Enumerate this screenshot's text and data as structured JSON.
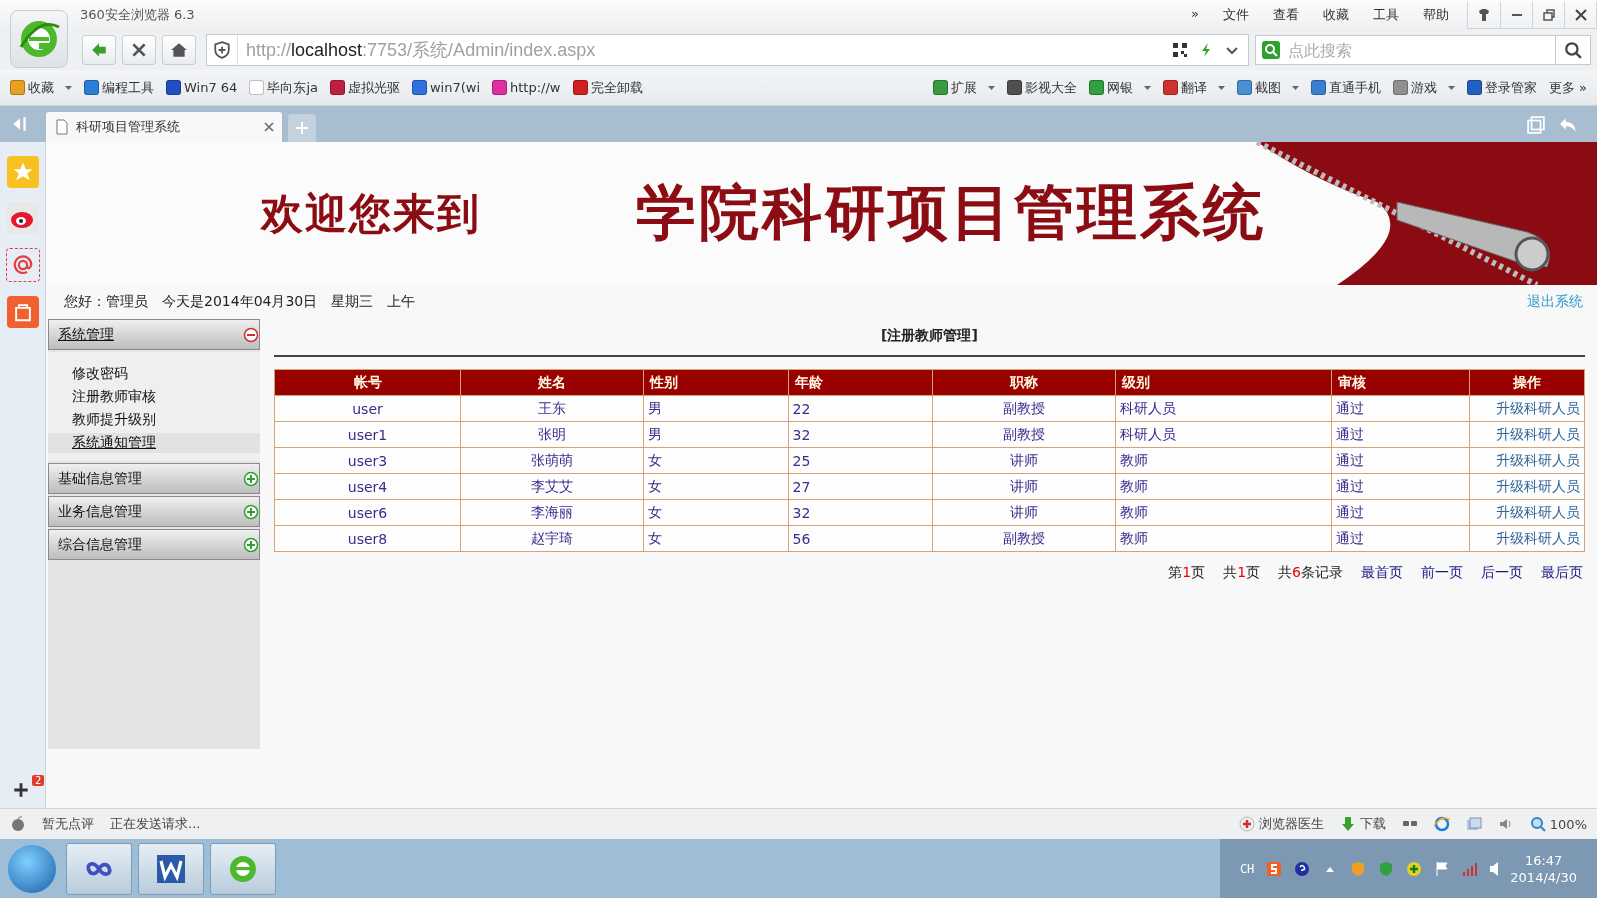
{
  "browser": {
    "title": "360安全浏览器 6.3",
    "menu": [
      "»",
      "文件",
      "查看",
      "收藏",
      "工具",
      "帮助"
    ],
    "url": "http://**localhost**:7753/系统/Admin/index.aspx",
    "search_placeholder": "点此搜索"
  },
  "bookmarks": [
    {
      "label": "收藏",
      "dropdown": true,
      "color": "#e8a020"
    },
    {
      "label": "编程工具",
      "dropdown": false,
      "color": "#2a7fd4"
    },
    {
      "label": "Win7 64",
      "dropdown": false,
      "color": "#2050c0"
    },
    {
      "label": "毕向东ja",
      "dropdown": false,
      "color": "#ffffff"
    },
    {
      "label": "虚拟光驱",
      "dropdown": false,
      "color": "#c02040"
    },
    {
      "label": "win7(wi",
      "dropdown": false,
      "color": "#3070e0"
    },
    {
      "label": "http://w",
      "dropdown": false,
      "color": "#e030a0"
    },
    {
      "label": "完全卸载",
      "dropdown": false,
      "color": "#d02020"
    }
  ],
  "toolbar_right": [
    {
      "label": "扩展",
      "dropdown": true,
      "color": "#3a9a40"
    },
    {
      "label": "影视大全",
      "dropdown": false,
      "color": "#505050"
    },
    {
      "label": "网银",
      "dropdown": true,
      "color": "#30a040"
    },
    {
      "label": "翻译",
      "dropdown": true,
      "color": "#d03030"
    },
    {
      "label": "截图",
      "dropdown": true,
      "color": "#4a90d0"
    },
    {
      "label": "直通手机",
      "dropdown": false,
      "color": "#3a80d0"
    },
    {
      "label": "游戏",
      "dropdown": true,
      "color": "#909090"
    },
    {
      "label": "登录管家",
      "dropdown": false,
      "color": "#2060c0"
    }
  ],
  "more": "更多 »",
  "tabs": [
    {
      "label": "科研项目管理系统",
      "selected": true
    }
  ],
  "side_badge": "2",
  "page": {
    "banner": {
      "welcome": "欢迎您来到",
      "title": "学院科研项目管理系统"
    },
    "greeting": [
      "您好：管理员",
      "今天是2014年04月30日",
      "星期三",
      "上午"
    ],
    "logout": "退出系统",
    "menu": [
      {
        "label": "系统管理",
        "expanded": true,
        "children": [
          {
            "label": "修改密码",
            "selected": false
          },
          {
            "label": "注册教师审核",
            "selected": false
          },
          {
            "label": "教师提升级别",
            "selected": false
          },
          {
            "label": "系统通知管理",
            "selected": true
          }
        ]
      },
      {
        "label": "基础信息管理",
        "expanded": false
      },
      {
        "label": "业务信息管理",
        "expanded": false
      },
      {
        "label": "综合信息管理",
        "expanded": false
      }
    ],
    "section_title": "[注册教师管理]",
    "table": {
      "columns": [
        "帐号",
        "姓名",
        "性别",
        "年龄",
        "职称",
        "级别",
        "审核",
        "操作"
      ],
      "rows": [
        [
          "user",
          "王东",
          "男",
          "22",
          "副教授",
          "科研人员",
          "通过",
          "升级科研人员"
        ],
        [
          "user1",
          "张明",
          "男",
          "32",
          "副教授",
          "科研人员",
          "通过",
          "升级科研人员"
        ],
        [
          "user3",
          "张萌萌",
          "女",
          "25",
          "讲师",
          "教师",
          "通过",
          "升级科研人员"
        ],
        [
          "user4",
          "李艾艾",
          "女",
          "27",
          "讲师",
          "教师",
          "通过",
          "升级科研人员"
        ],
        [
          "user6",
          "李海丽",
          "女",
          "32",
          "讲师",
          "教师",
          "通过",
          "升级科研人员"
        ],
        [
          "user8",
          "赵宇琦",
          "女",
          "56",
          "副教授",
          "教师",
          "通过",
          "升级科研人员"
        ]
      ]
    },
    "pager": {
      "status": [
        {
          "before": "第",
          "number": "1",
          "after": "页"
        },
        {
          "before": "共",
          "number": "1",
          "after": "页"
        },
        {
          "before": "共",
          "number": "6",
          "after": "条记录"
        }
      ],
      "links": [
        "最首页",
        "前一页",
        "后一页",
        "最后页"
      ]
    }
  },
  "status_bar": {
    "left": [
      "暂无点评",
      "正在发送请求..."
    ],
    "doctor": "浏览器医生",
    "download": "下载",
    "zoom": "100%"
  },
  "taskbar": {
    "ime": "CH",
    "time": "16:47",
    "date": "2014/4/30"
  }
}
